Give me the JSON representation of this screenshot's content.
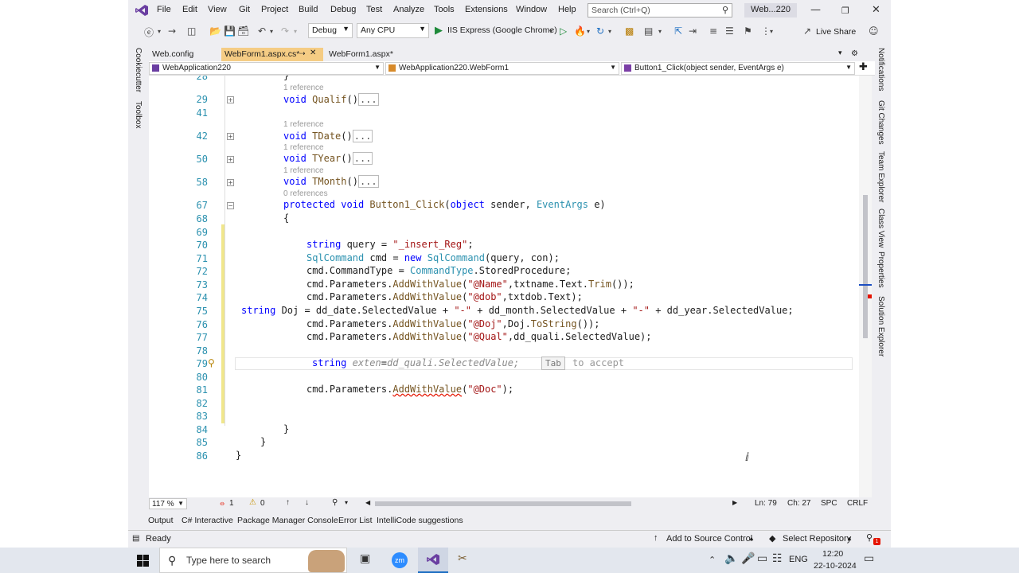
{
  "menu": [
    "File",
    "Edit",
    "View",
    "Git",
    "Project",
    "Build",
    "Debug",
    "Test",
    "Analyze",
    "Tools",
    "Extensions",
    "Window",
    "Help"
  ],
  "search_placeholder": "Search (Ctrl+Q)",
  "window_title": "Web...220",
  "toolbar": {
    "config": "Debug",
    "platform": "Any CPU",
    "run_target": "IIS Express (Google Chrome)",
    "live_share": "Live Share"
  },
  "tabs": [
    {
      "label": "Web.config",
      "active": false
    },
    {
      "label": "WebForm1.aspx.cs*",
      "active": true
    },
    {
      "label": "WebForm1.aspx*",
      "active": false
    }
  ],
  "nav": {
    "project": "WebApplication220",
    "class": "WebApplication220.WebForm1",
    "member": "Button1_Click(object sender, EventArgs e)"
  },
  "side_left": [
    "Cookiecutter",
    "Toolbox"
  ],
  "side_right": [
    "Notifications",
    "Git Changes",
    "Team Explorer",
    "Class View",
    "Properties",
    "Solution Explorer"
  ],
  "code": {
    "refs": [
      "1 reference",
      "1 reference",
      "1 reference",
      "1 reference",
      "0 references"
    ],
    "line_numbers": [
      "28",
      "29",
      "41",
      "42",
      "50",
      "58",
      "67",
      "68",
      "69",
      "70",
      "71",
      "72",
      "73",
      "74",
      "75",
      "76",
      "77",
      "78",
      "79",
      "80",
      "81",
      "82",
      "83",
      "84",
      "85",
      "86"
    ],
    "ghost_suggestion": "dd_quali.SelectedValue;",
    "tab_hint": "Tab",
    "accept_hint": "to accept"
  },
  "editor_status": {
    "zoom": "117 %",
    "errors": "1",
    "warnings": "0",
    "line": "Ln: 79",
    "col": "Ch: 27",
    "spc": "SPC",
    "crlf": "CRLF"
  },
  "bottom_tabs": [
    "Output",
    "C# Interactive",
    "Package Manager Console",
    "Error List",
    "IntelliCode suggestions"
  ],
  "status": {
    "ready": "Ready",
    "source_control": "Add to Source Control",
    "repository": "Select Repository",
    "notifications": "1"
  },
  "taskbar": {
    "search_text": "Type here to search",
    "lang": "ENG",
    "time": "12:20",
    "date": "22-10-2024"
  }
}
